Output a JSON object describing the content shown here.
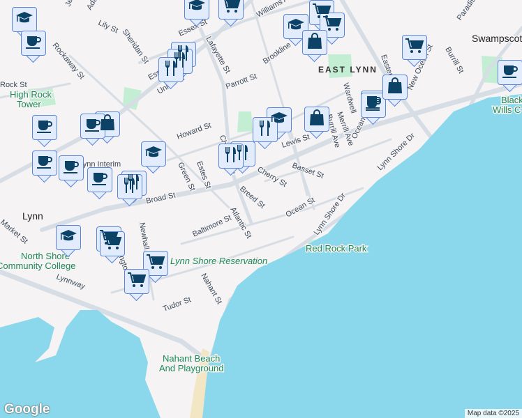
{
  "colors": {
    "water": "#8bd8ec",
    "land": "#f5f3f3",
    "road": "#d7dde5",
    "park": "#c4eed4",
    "marker_bg": "#e3ecfc",
    "marker_border": "#5b86d8",
    "icon": "#0b4266"
  },
  "labels": {
    "towns": {
      "swampscott": "Swampscott",
      "lynn": "Lynn",
      "lynn_interim": "Lynn Interim"
    },
    "neighborhoods": {
      "east_lynn": "EAST LYNN"
    },
    "parks": {
      "high_rock": [
        "High Rock",
        "Tower"
      ],
      "lynn_shore": "Lynn Shore Reservation",
      "red_rock": "Red Rock Park",
      "nahant_beach": [
        "Nahant Beach",
        "And Playground"
      ],
      "black_wills": [
        "Black",
        "Wills C"
      ],
      "nscc": [
        "North Shore",
        "Community College"
      ]
    },
    "streets": [
      "Essex St",
      "Essex St",
      "Union St",
      "Parrott St",
      "Brookline",
      "Lily St",
      "Sheridan St",
      "Rockaway St",
      "Rock St",
      "Howard St",
      "Green St",
      "Estes St",
      "Chatham St",
      "Lewis St",
      "Basset St",
      "Cherry St",
      "Breed St",
      "Atlantic St",
      "Broad St",
      "Baltimore St",
      "Ocean St",
      "Ocean St",
      "Lynn Shore Dr",
      "Lynn Shore Dr",
      "Eastern Ave",
      "New Ocean St",
      "Burrill St",
      "Burrill Ave",
      "Merrill Ave",
      "Wardwell",
      "Market St",
      "Newhall St",
      "Washington St",
      "Lynnway",
      "Nahant St",
      "Tudor St",
      "Williams Ave",
      "Paradise",
      "Lafayette St",
      "Adams",
      "Jeff"
    ]
  },
  "markers": [
    "school",
    "cafe",
    "school",
    "shopping-cart",
    "restaurant",
    "restaurant",
    "restaurant",
    "cafe",
    "shopping-bag",
    "school",
    "cafe",
    "cafe",
    "cafe",
    "cafe",
    "restaurant",
    "restaurant",
    "restaurant",
    "restaurant",
    "school",
    "restaurant",
    "school",
    "shopping-cart",
    "shopping-cart",
    "shopping-bag",
    "shopping-bag",
    "cafe",
    "cafe",
    "shopping-bag",
    "shopping-cart",
    "cafe",
    "school",
    "shopping-cart",
    "shopping-cart",
    "shopping-cart",
    "shopping-cart"
  ],
  "branding": {
    "logo": "Google",
    "attribution": "Map data ©2025"
  }
}
